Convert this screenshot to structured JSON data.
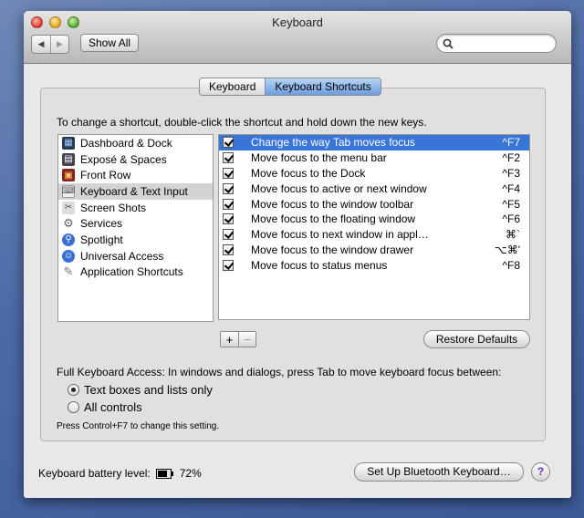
{
  "window": {
    "title": "Keyboard"
  },
  "toolbar": {
    "back_label": "◀",
    "forward_label": "▶",
    "show_all": "Show All",
    "search_placeholder": ""
  },
  "tabs": [
    {
      "label": "Keyboard"
    },
    {
      "label": "Keyboard Shortcuts"
    }
  ],
  "instructions": "To change a shortcut, double-click the shortcut and hold down the new keys.",
  "categories": [
    {
      "label": "Dashboard & Dock",
      "icon": "dashboard-icon"
    },
    {
      "label": "Exposé & Spaces",
      "icon": "expose-icon"
    },
    {
      "label": "Front Row",
      "icon": "front-row-icon"
    },
    {
      "label": "Keyboard & Text Input",
      "icon": "keyboard-icon"
    },
    {
      "label": "Screen Shots",
      "icon": "screenshot-icon"
    },
    {
      "label": "Services",
      "icon": "services-gear-icon"
    },
    {
      "label": "Spotlight",
      "icon": "spotlight-icon"
    },
    {
      "label": "Universal Access",
      "icon": "universal-access-icon"
    },
    {
      "label": "Application Shortcuts",
      "icon": "application-icon"
    }
  ],
  "shortcuts": [
    {
      "action": "Change the way Tab moves focus",
      "key": "^F7"
    },
    {
      "action": "Move focus to the menu bar",
      "key": "^F2"
    },
    {
      "action": "Move focus to the Dock",
      "key": "^F3"
    },
    {
      "action": "Move focus to active or next window",
      "key": "^F4"
    },
    {
      "action": "Move focus to the window toolbar",
      "key": "^F5"
    },
    {
      "action": "Move focus to the floating window",
      "key": "^F6"
    },
    {
      "action": "Move focus to next window in appl…",
      "key": "⌘`"
    },
    {
      "action": "Move focus to the window drawer",
      "key": "⌥⌘'"
    },
    {
      "action": "Move focus to status menus",
      "key": "^F8"
    }
  ],
  "buttons": {
    "add": "+",
    "remove": "−",
    "restore_defaults": "Restore Defaults",
    "bluetooth": "Set Up Bluetooth Keyboard…",
    "help": "?"
  },
  "full_keyboard_access": {
    "label": "Full Keyboard Access: In windows and dialogs, press Tab to move keyboard focus between:",
    "options": [
      "Text boxes and lists only",
      "All controls"
    ],
    "selected": 0,
    "note": "Press Control+F7 to change this setting."
  },
  "battery": {
    "label": "Keyboard battery level:",
    "value": "72%"
  },
  "colors": {
    "selection": "#3875d7",
    "accent_tab": "#6c9de0"
  }
}
